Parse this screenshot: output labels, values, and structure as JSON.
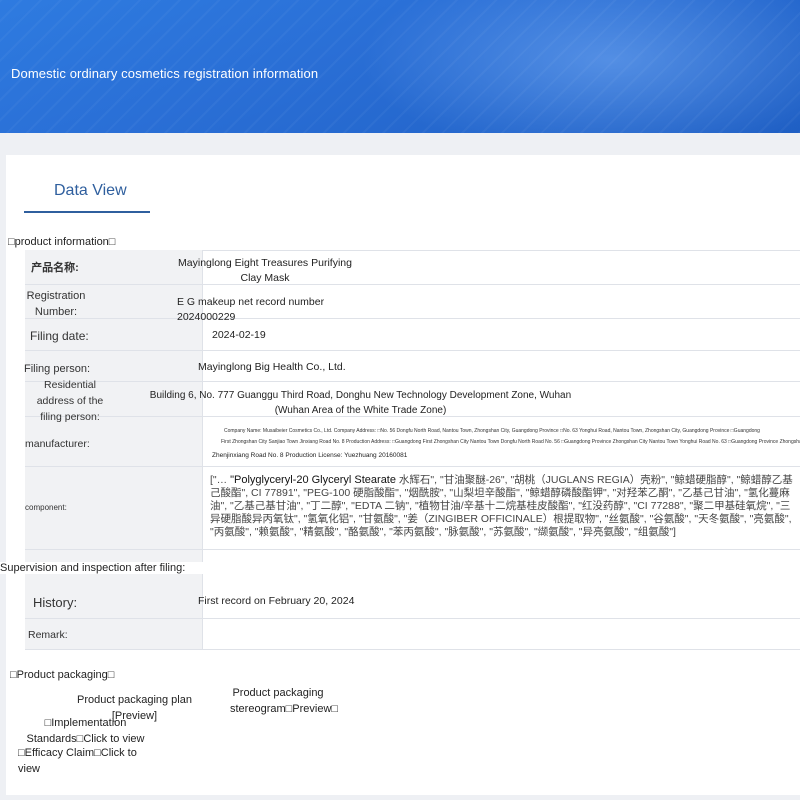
{
  "header": {
    "title": "Domestic ordinary cosmetics registration information"
  },
  "tabs": [
    {
      "label": "Data View",
      "active": true
    }
  ],
  "sections": {
    "product_information": "□product information□",
    "supervision": "Supervision and inspection after filing:",
    "product_packaging": "□Product packaging□",
    "implementation_standards": "□Implementation Standards□Click to view",
    "efficacy_claim": "□Efficacy Claim□Click to view"
  },
  "product": {
    "name_label": "产品名称:",
    "name_value": "Mayinglong Eight Treasures Purifying Clay Mask",
    "registration_label": "Registration Number:",
    "registration_value": "E G makeup net record number 2024000229",
    "filing_date_label": "Filing date:",
    "filing_date_value": "2024-02-19",
    "filing_person_label": "Filing person:",
    "filing_person_value": "Mayinglong Big Health Co., Ltd.",
    "address_label": "Residential address of the filing person:",
    "address_value": "Building 6, No. 777 Guanggu Third Road, Donghu New Technology Development Zone, Wuhan (Wuhan Area of the White Trade Zone)",
    "manufacturer_label": "manufacturer:",
    "manufacturer_line1": "Company Name: Musaibeier Cosmetics Co., Ltd. Company Address: □No. 56 Dongfu North Road, Nantou Town, Zhongshan City, Guangdong Province □No. 63 Yonghui Road, Nantou Town, Zhongshan City, Guangdong Province □Guangdong",
    "manufacturer_line2": "First Zhongshan City Sanjiao Town Jinxiang Road No. 8 Production Address: □Guangdong First Zhongshan City Nantou Town Dongfu North Road No. 56 □Guangdong Province Zhongshan City Nantou Town Yonghui Road No. 63 □Guangdong Province Zhongshan",
    "manufacturer_line3": "Zhenjinxiang Road No. 8 Production License: Yuezhuang 20160081",
    "component_label": "component:",
    "component_prefix": "[\"…",
    "component_highlight": "\"Polyglyceryl-20 Glyceryl Stearate",
    "component_value": "水辉石\", \"甘油聚醚-26\", \"胡桃（JUGLANS REGIA）壳粉\", \"鲸蜡硬脂醇\", \"鲸蜡醇乙基己酸酯\", CI 77891\", \"PEG-100 硬脂酸酯\", \"烟酰胺\", \"山梨坦辛酸酯\", \"鲸蜡醇磷酸酯钾\", \"对羟苯乙酮\", \"乙基己甘油\", \"氢化蔓麻油\", \"乙基己基甘油\", \"丁二醇\", \"EDTA 二钠\", \"植物甘油/辛基十二烷基桂皮酸酯\", \"红没药醇\", \"CI 77288\", \"聚二甲基硅氧烷\", \"三异硬脂酸异丙氧钛\", \"氢氧化铝\", \"甘氨酸\", \"姜（ZINGIBER OFFICINALE）根提取物\", \"丝氨酸\", \"谷氨酸\", \"天冬氨酸\", \"亮氨酸\", \"丙氨酸\", \"赖氨酸\", \"精氨酸\", \"酪氨酸\", \"苯丙氨酸\", \"脉氨酸\", \"苏氨酸\", \"缬氨酸\", \"异亮氨酸\", \"组氨酸\"]"
  },
  "supervision": {
    "history_label": "History:",
    "history_value": "First record on February 20, 2024",
    "remark_label": "Remark:",
    "remark_value": ""
  },
  "packaging": {
    "plan_link": "Product packaging plan [Preview]",
    "stereogram_link": "Product packaging stereogram□Preview□"
  },
  "colors": {
    "banner": "#2a6fd6",
    "tab_accent": "#2f5f9e",
    "label_bg": "#f1f2f4"
  }
}
